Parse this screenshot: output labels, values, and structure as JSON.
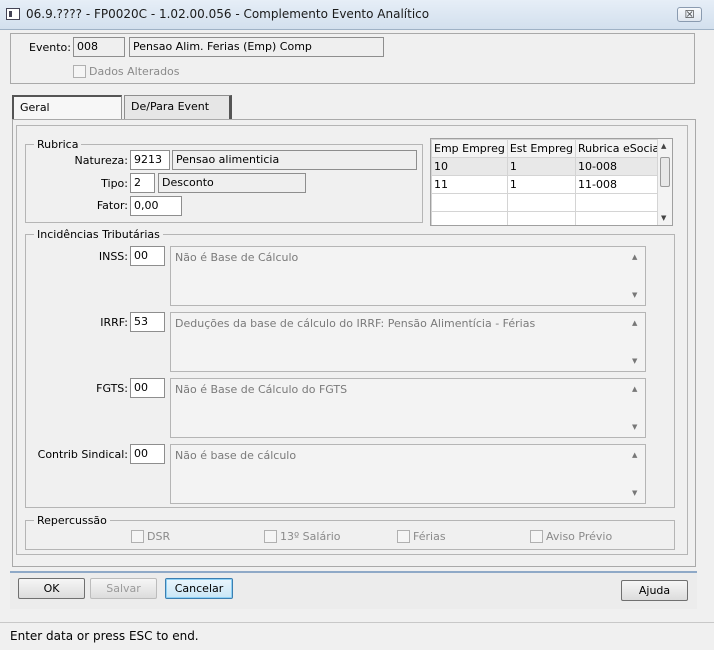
{
  "window": {
    "title": "06.9.???? - FP0020C - 1.02.00.056 - Complemento Evento Analítico",
    "close_symbol": "☒"
  },
  "header": {
    "evento_label": "Evento:",
    "evento_code": "008",
    "evento_desc": "Pensao Alim. Ferias (Emp) Comp",
    "dados_alterados_label": "Dados Alterados"
  },
  "tabs": [
    {
      "label": "Geral"
    },
    {
      "label": "De/Para Event"
    }
  ],
  "rubrica": {
    "legend": "Rubrica",
    "natureza_label": "Natureza:",
    "natureza_code": "9213",
    "natureza_desc": "Pensao alimenticia",
    "tipo_label": "Tipo:",
    "tipo_code": "2",
    "tipo_desc": "Desconto",
    "fator_label": "Fator:",
    "fator_value": "0,00"
  },
  "grid": {
    "columns": [
      "Emp Empreg",
      "Est Empreg",
      "Rubrica eSocial"
    ],
    "rows": [
      [
        "10",
        "1",
        "10-008"
      ],
      [
        "11",
        "1",
        "11-008"
      ],
      [
        "",
        "",
        ""
      ],
      [
        "",
        "",
        ""
      ]
    ]
  },
  "incidencias": {
    "legend": "Incidências Tributárias",
    "items": [
      {
        "label": "INSS:",
        "code": "00",
        "desc": "Não é Base de Cálculo"
      },
      {
        "label": "IRRF:",
        "code": "53",
        "desc": "Deduções da base de cálculo do IRRF: Pensão Alimentícia - Férias"
      },
      {
        "label": "FGTS:",
        "code": "00",
        "desc": "Não é Base de Cálculo do FGTS"
      },
      {
        "label": "Contrib Sindical:",
        "code": "00",
        "desc": "Não é base de cálculo"
      }
    ]
  },
  "repercussao": {
    "legend": "Repercussão",
    "items": [
      "DSR",
      "13º Salário",
      "Férias",
      "Aviso Prévio"
    ]
  },
  "buttons": {
    "ok": "OK",
    "salvar": "Salvar",
    "cancelar": "Cancelar",
    "ajuda": "Ajuda"
  },
  "status": {
    "text": "Enter data or press ESC to end."
  },
  "icons": {
    "scroll_up": "▲",
    "scroll_down": "▼"
  }
}
